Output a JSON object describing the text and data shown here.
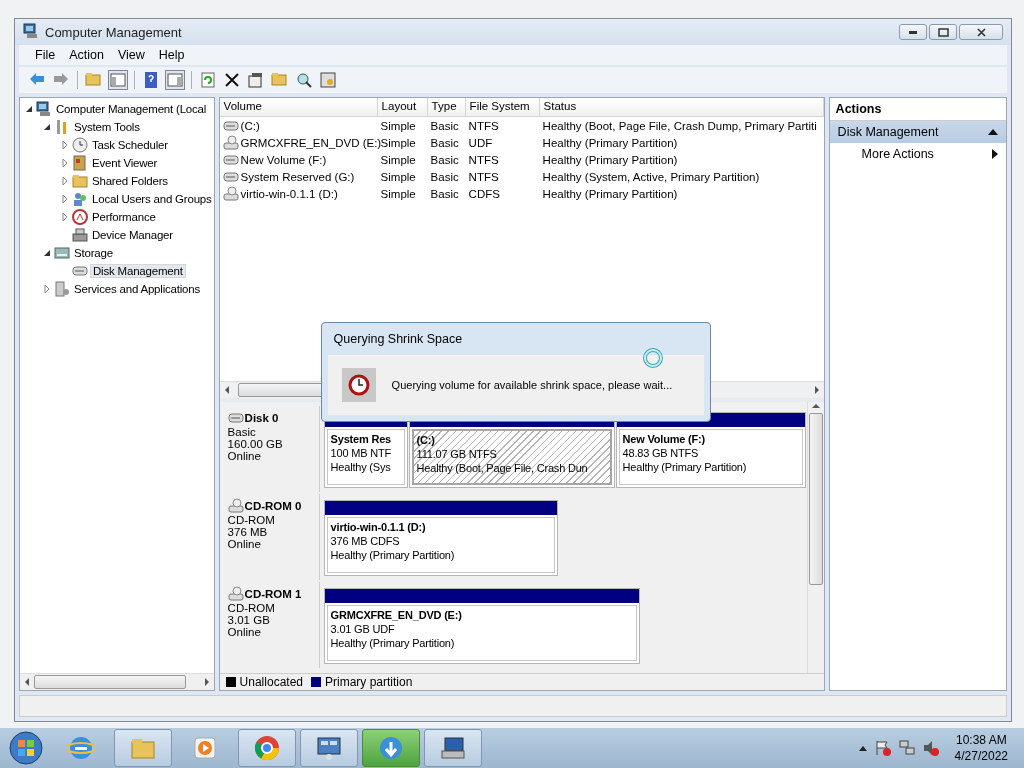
{
  "window": {
    "title": "Computer Management"
  },
  "menu": [
    {
      "label": "File"
    },
    {
      "label": "Action"
    },
    {
      "label": "View"
    },
    {
      "label": "Help"
    }
  ],
  "tree": [
    {
      "label": "Computer Management (Local",
      "expandable": true,
      "expanded": true,
      "selected": false,
      "children": [
        {
          "label": "System Tools",
          "expandable": true,
          "expanded": true,
          "selected": false,
          "children": [
            {
              "label": "Task Scheduler",
              "expandable": true,
              "expanded": false,
              "selected": false
            },
            {
              "label": "Event Viewer",
              "expandable": true,
              "expanded": false,
              "selected": false
            },
            {
              "label": "Shared Folders",
              "expandable": true,
              "expanded": false,
              "selected": false
            },
            {
              "label": "Local Users and Groups",
              "expandable": true,
              "expanded": false,
              "selected": false
            },
            {
              "label": "Performance",
              "expandable": true,
              "expanded": false,
              "selected": false
            },
            {
              "label": "Device Manager",
              "expandable": false,
              "selected": false
            }
          ]
        },
        {
          "label": "Storage",
          "expandable": true,
          "expanded": true,
          "selected": false,
          "children": [
            {
              "label": "Disk Management",
              "expandable": false,
              "selected": true
            }
          ]
        },
        {
          "label": "Services and Applications",
          "expandable": true,
          "expanded": false,
          "selected": false
        }
      ]
    }
  ],
  "volumes": {
    "columns": [
      "Volume",
      "Layout",
      "Type",
      "File System",
      "Status"
    ],
    "rows": [
      {
        "kind": "disk",
        "cells": [
          "(C:)",
          "Simple",
          "Basic",
          "NTFS",
          "Healthy (Boot, Page File, Crash Dump, Primary Partiti"
        ]
      },
      {
        "kind": "cdrom",
        "cells": [
          "GRMCXFRE_EN_DVD (E:)",
          "Simple",
          "Basic",
          "UDF",
          "Healthy (Primary Partition)"
        ]
      },
      {
        "kind": "disk",
        "cells": [
          "New Volume (F:)",
          "Simple",
          "Basic",
          "NTFS",
          "Healthy (Primary Partition)"
        ]
      },
      {
        "kind": "disk",
        "cells": [
          "System Reserved (G:)",
          "Simple",
          "Basic",
          "NTFS",
          "Healthy (System, Active, Primary Partition)"
        ]
      },
      {
        "kind": "cdrom",
        "cells": [
          "virtio-win-0.1.1 (D:)",
          "Simple",
          "Basic",
          "CDFS",
          "Healthy (Primary Partition)"
        ]
      }
    ]
  },
  "disks": [
    {
      "kind": "disk",
      "name": "Disk 0",
      "details": [
        "Basic",
        "160.00 GB",
        "Online"
      ],
      "partitions": [
        {
          "name": "System Res",
          "size": "100 MB NTF",
          "status": "Healthy (Sys",
          "selected": false
        },
        {
          "name": "(C:)",
          "size": "111.07 GB NTFS",
          "status": "Healthy (Boot, Page File, Crash Dun",
          "selected": true
        },
        {
          "name": "New Volume  (F:)",
          "size": "48.83 GB NTFS",
          "status": "Healthy (Primary Partition)",
          "selected": false
        }
      ]
    },
    {
      "kind": "cdrom",
      "name": "CD-ROM 0",
      "details": [
        "CD-ROM",
        "376 MB",
        "Online"
      ],
      "partitions": [
        {
          "name": "virtio-win-0.1.1  (D:)",
          "size": "376 MB CDFS",
          "status": "Healthy (Primary Partition)",
          "selected": false
        }
      ]
    },
    {
      "kind": "cdrom",
      "name": "CD-ROM 1",
      "details": [
        "CD-ROM",
        "3.01 GB",
        "Online"
      ],
      "partitions": [
        {
          "name": "GRMCXFRE_EN_DVD  (E:)",
          "size": "3.01 GB UDF",
          "status": "Healthy (Primary Partition)",
          "selected": false
        }
      ]
    }
  ],
  "legend": [
    {
      "label": "Unallocated",
      "color": "#000000"
    },
    {
      "label": "Primary partition",
      "color": "#000080"
    }
  ],
  "actions": {
    "title": "Actions",
    "section": {
      "label": "Disk Management",
      "expanded": true
    },
    "items": [
      {
        "label": "More Actions"
      }
    ]
  },
  "dialog": {
    "title": "Querying Shrink Space",
    "message": "Querying volume for available shrink space, please wait..."
  },
  "clock": {
    "time": "10:38 AM",
    "date": "4/27/2022"
  }
}
